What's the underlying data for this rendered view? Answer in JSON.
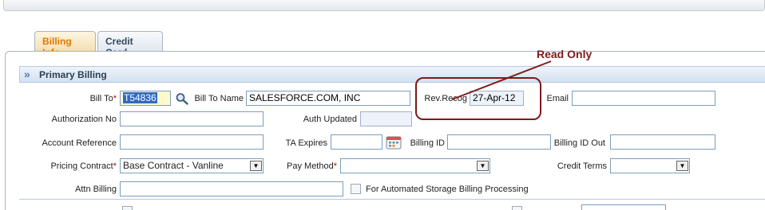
{
  "tabs": {
    "billing_info": "Billing Info",
    "credit_card": "Credit Card"
  },
  "section": {
    "title": "Primary Billing"
  },
  "fields": {
    "bill_to_label": "Bill To",
    "bill_to_value": "T54836",
    "bill_to_name_label": "Bill To Name",
    "bill_to_name_value": "SALESFORCE.COM, INC",
    "rev_recog_label": "Rev.Recog",
    "rev_recog_value": "27-Apr-12",
    "email_label": "Email",
    "email_value": "",
    "authorization_no_label": "Authorization No",
    "authorization_no_value": "",
    "auth_updated_label": "Auth Updated",
    "auth_updated_value": "",
    "account_reference_label": "Account Reference",
    "account_reference_value": "",
    "ta_expires_label": "TA Expires",
    "ta_expires_value": "",
    "billing_id_label": "Billing ID",
    "billing_id_value": "",
    "billing_id_out_label": "Billing ID Out",
    "billing_id_out_value": "",
    "pricing_contract_label": "Pricing Contract",
    "pricing_contract_value": "Base Contract - Vanline",
    "pay_method_label": "Pay Method",
    "pay_method_value": "",
    "credit_terms_label": "Credit Terms",
    "credit_terms_value": "",
    "attn_billing_label": "Attn Billing",
    "attn_billing_value": "",
    "automated_storage_label": "For Automated Storage Billing Processing",
    "required_marker": "*"
  },
  "annotation": {
    "text": "Read Only",
    "color": "#7d1a1a"
  },
  "icons": {
    "lookup": "magnifier-icon",
    "calendar": "calendar-icon",
    "section": "double-chevron-icon"
  }
}
